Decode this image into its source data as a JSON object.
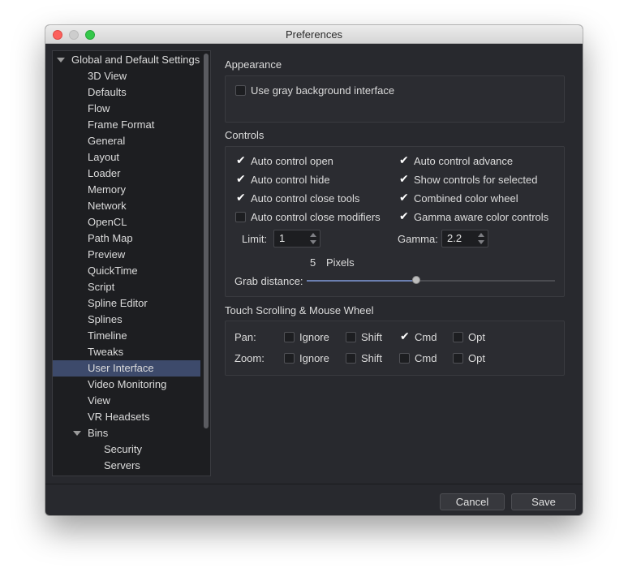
{
  "window": {
    "title": "Preferences"
  },
  "sidebar": {
    "items": [
      {
        "label": "Global and Default Settings",
        "level": 0,
        "expanded": true
      },
      {
        "label": "3D View",
        "level": 1
      },
      {
        "label": "Defaults",
        "level": 1
      },
      {
        "label": "Flow",
        "level": 1
      },
      {
        "label": "Frame Format",
        "level": 1
      },
      {
        "label": "General",
        "level": 1
      },
      {
        "label": "Layout",
        "level": 1
      },
      {
        "label": "Loader",
        "level": 1
      },
      {
        "label": "Memory",
        "level": 1
      },
      {
        "label": "Network",
        "level": 1
      },
      {
        "label": "OpenCL",
        "level": 1
      },
      {
        "label": "Path Map",
        "level": 1
      },
      {
        "label": "Preview",
        "level": 1
      },
      {
        "label": "QuickTime",
        "level": 1
      },
      {
        "label": "Script",
        "level": 1
      },
      {
        "label": "Spline Editor",
        "level": 1
      },
      {
        "label": "Splines",
        "level": 1
      },
      {
        "label": "Timeline",
        "level": 1
      },
      {
        "label": "Tweaks",
        "level": 1
      },
      {
        "label": "User Interface",
        "level": 1,
        "selected": true
      },
      {
        "label": "Video Monitoring",
        "level": 1
      },
      {
        "label": "View",
        "level": 1
      },
      {
        "label": "VR Headsets",
        "level": 1
      },
      {
        "label": "Bins",
        "level": 1,
        "expanded": true
      },
      {
        "label": "Security",
        "level": 2
      },
      {
        "label": "Servers",
        "level": 2
      }
    ]
  },
  "appearance": {
    "heading": "Appearance",
    "gray_background": {
      "label": "Use gray background interface",
      "checked": false
    }
  },
  "controls": {
    "heading": "Controls",
    "auto_control_open": {
      "label": "Auto control open",
      "checked": true
    },
    "auto_control_hide": {
      "label": "Auto control hide",
      "checked": true
    },
    "auto_control_close_tools": {
      "label": "Auto control close tools",
      "checked": true
    },
    "auto_control_close_modifiers": {
      "label": "Auto control close modifiers",
      "checked": false
    },
    "auto_control_advance": {
      "label": "Auto control advance",
      "checked": true
    },
    "show_controls_for_selected": {
      "label": "Show controls for selected",
      "checked": true
    },
    "combined_color_wheel": {
      "label": "Combined color wheel",
      "checked": true
    },
    "gamma_aware_color_controls": {
      "label": "Gamma aware color controls",
      "checked": true
    },
    "limit_label": "Limit:",
    "limit_value": "1",
    "gamma_label": "Gamma:",
    "gamma_value": "2.2",
    "grab_value": "5",
    "grab_unit": "Pixels",
    "grab_label": "Grab distance:",
    "grab_fraction": 0.44
  },
  "touch": {
    "heading": "Touch Scrolling & Mouse Wheel",
    "pan_label": "Pan:",
    "zoom_label": "Zoom:",
    "options": [
      "Ignore",
      "Shift",
      "Cmd",
      "Opt"
    ],
    "pan": [
      false,
      false,
      true,
      false
    ],
    "zoom": [
      false,
      false,
      false,
      false
    ]
  },
  "buttons": {
    "cancel": "Cancel",
    "save": "Save"
  },
  "icons": {
    "checkmark": "check-icon",
    "tree_expand": "disclosure-triangle-icon"
  }
}
